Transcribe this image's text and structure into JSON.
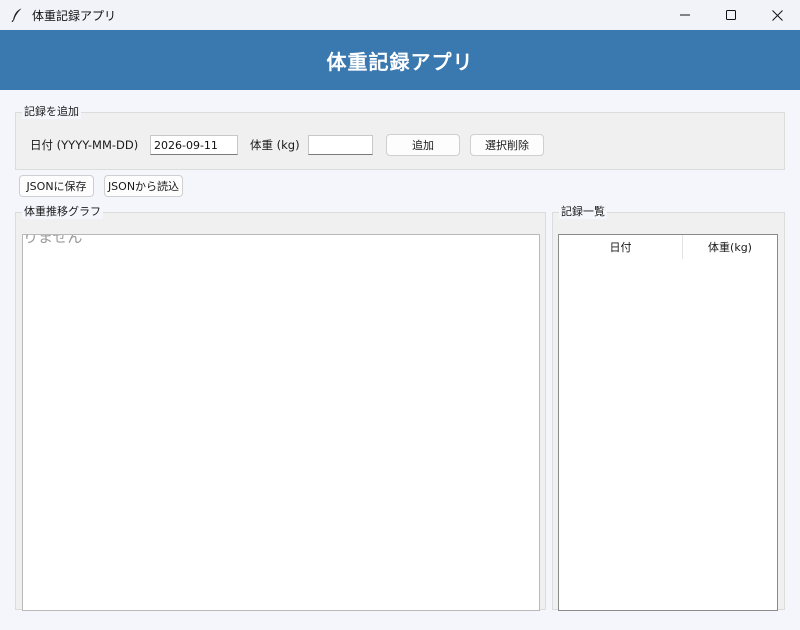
{
  "window": {
    "title": "体重記録アプリ",
    "controls": [
      "minimize",
      "maximize",
      "close"
    ]
  },
  "header": {
    "title": "体重記録アプリ",
    "background": "#3a78b0"
  },
  "add_section": {
    "legend": "記録を追加",
    "date_label": "日付 (YYYY-MM-DD)",
    "date_value": "2026-09-11",
    "weight_label": "体重 (kg)",
    "weight_value": "",
    "add_button": "追加",
    "delete_button": "選択削除"
  },
  "file_actions": {
    "save_json": "JSONに保存",
    "load_json": "JSONから読込"
  },
  "graph_section": {
    "legend": "体重推移グラフ",
    "message": "りません"
  },
  "records_section": {
    "legend": "記録一覧",
    "columns": [
      "日付",
      "体重(kg)"
    ],
    "rows": []
  }
}
